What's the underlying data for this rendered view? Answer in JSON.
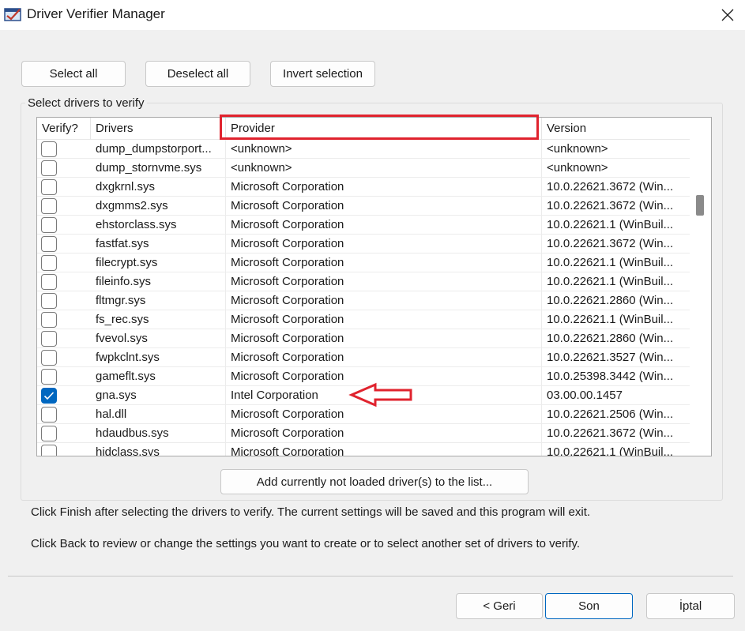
{
  "window": {
    "title": "Driver Verifier Manager",
    "icon": "driver-verifier-app-icon",
    "close_icon": "close-icon"
  },
  "toolbar": {
    "select_all": "Select all",
    "deselect_all": "Deselect all",
    "invert_selection": "Invert selection"
  },
  "group": {
    "label": "Select drivers to verify"
  },
  "table": {
    "headers": {
      "verify": "Verify?",
      "drivers": "Drivers",
      "provider": "Provider",
      "version": "Version"
    },
    "rows": [
      {
        "checked": false,
        "driver": "dump_dumpstorport...",
        "provider": "<unknown>",
        "version": "<unknown>"
      },
      {
        "checked": false,
        "driver": "dump_stornvme.sys",
        "provider": "<unknown>",
        "version": "<unknown>"
      },
      {
        "checked": false,
        "driver": "dxgkrnl.sys",
        "provider": "Microsoft Corporation",
        "version": "10.0.22621.3672 (Win..."
      },
      {
        "checked": false,
        "driver": "dxgmms2.sys",
        "provider": "Microsoft Corporation",
        "version": "10.0.22621.3672 (Win..."
      },
      {
        "checked": false,
        "driver": "ehstorclass.sys",
        "provider": "Microsoft Corporation",
        "version": "10.0.22621.1 (WinBuil..."
      },
      {
        "checked": false,
        "driver": "fastfat.sys",
        "provider": "Microsoft Corporation",
        "version": "10.0.22621.3672 (Win..."
      },
      {
        "checked": false,
        "driver": "filecrypt.sys",
        "provider": "Microsoft Corporation",
        "version": "10.0.22621.1 (WinBuil..."
      },
      {
        "checked": false,
        "driver": "fileinfo.sys",
        "provider": "Microsoft Corporation",
        "version": "10.0.22621.1 (WinBuil..."
      },
      {
        "checked": false,
        "driver": "fltmgr.sys",
        "provider": "Microsoft Corporation",
        "version": "10.0.22621.2860 (Win..."
      },
      {
        "checked": false,
        "driver": "fs_rec.sys",
        "provider": "Microsoft Corporation",
        "version": "10.0.22621.1 (WinBuil..."
      },
      {
        "checked": false,
        "driver": "fvevol.sys",
        "provider": "Microsoft Corporation",
        "version": "10.0.22621.2860 (Win..."
      },
      {
        "checked": false,
        "driver": "fwpkclnt.sys",
        "provider": "Microsoft Corporation",
        "version": "10.0.22621.3527 (Win..."
      },
      {
        "checked": false,
        "driver": "gameflt.sys",
        "provider": "Microsoft Corporation",
        "version": "10.0.25398.3442 (Win..."
      },
      {
        "checked": true,
        "driver": "gna.sys",
        "provider": "Intel Corporation",
        "version": "03.00.00.1457"
      },
      {
        "checked": false,
        "driver": "hal.dll",
        "provider": "Microsoft Corporation",
        "version": "10.0.22621.2506 (Win..."
      },
      {
        "checked": false,
        "driver": "hdaudbus.sys",
        "provider": "Microsoft Corporation",
        "version": "10.0.22621.3672 (Win..."
      },
      {
        "checked": false,
        "driver": "hidclass.sys",
        "provider": "Microsoft Corporation",
        "version": "10.0.22621.1 (WinBuil..."
      }
    ]
  },
  "add_button": "Add currently not loaded driver(s) to the list...",
  "info": {
    "line1": "Click Finish after selecting the drivers to verify. The current settings will be saved and this program will exit.",
    "line2": "Click Back to review or change the settings you want to create or to select another set of drivers to verify."
  },
  "footer": {
    "back": "< Geri",
    "finish": "Son",
    "cancel": "İptal"
  },
  "colors": {
    "accent": "#0067c0",
    "annotation": "#e0232e"
  }
}
